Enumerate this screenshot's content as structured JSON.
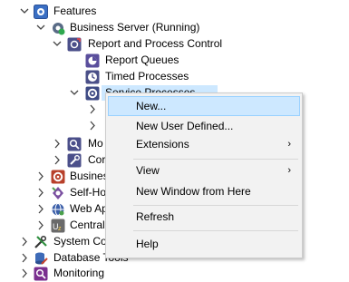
{
  "tree": {
    "items": [
      {
        "label": "Features",
        "icon": "features-gear-icon"
      },
      {
        "label": "Business Server (Running)",
        "icon": "server-running-icon"
      },
      {
        "label": "Report and Process Control",
        "icon": "report-process-icon"
      },
      {
        "label": "Report Queues",
        "icon": "report-queues-icon"
      },
      {
        "label": "Timed Processes",
        "icon": "timed-processes-icon"
      },
      {
        "label": "Service Processes",
        "icon": "service-processes-icon"
      },
      {
        "label": "",
        "icon": "folder-icon"
      },
      {
        "label": "",
        "icon": "folder-icon"
      },
      {
        "label": "Mo",
        "icon": "monitor-magnifier-icon"
      },
      {
        "label": "Cor",
        "icon": "wrench-icon"
      },
      {
        "label": "Busines",
        "icon": "business-gear-icon"
      },
      {
        "label": "Self-Ho",
        "icon": "self-host-icon"
      },
      {
        "label": "Web Ap",
        "icon": "globe-icon"
      },
      {
        "label": "Central",
        "icon": "central-icon"
      },
      {
        "label": "System Co",
        "icon": "system-tools-icon"
      },
      {
        "label": "Database Tools",
        "icon": "database-tools-icon"
      },
      {
        "label": "Monitoring",
        "icon": "monitoring-magnifier-icon"
      }
    ]
  },
  "context_menu": {
    "items": [
      {
        "label": "New...",
        "highlighted": true
      },
      {
        "label": "New User Defined..."
      },
      {
        "label": "Extensions",
        "submenu": "›"
      },
      {
        "label": "View",
        "submenu": "›"
      },
      {
        "label": "New Window from Here"
      },
      {
        "label": "Refresh"
      },
      {
        "label": "Help"
      }
    ]
  },
  "colors": {
    "selection": "#cde8ff",
    "menu_bg": "#f2f2f2",
    "highlight_border": "#99d1ff"
  }
}
